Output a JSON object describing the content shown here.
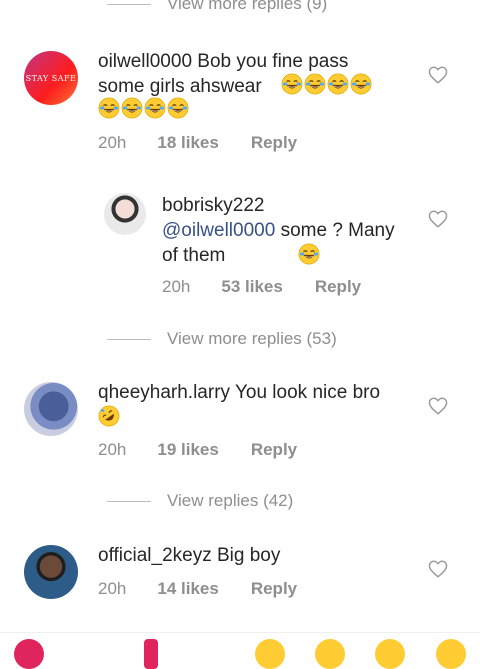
{
  "threads": [
    {
      "view_more": "View more replies (9)",
      "comment": {
        "username": "oilwell0000",
        "text": "Bob you fine pass some girls ahswear",
        "avatar_text": "STAY SAFE",
        "time": "20h",
        "likes": "18 likes",
        "reply": "Reply"
      }
    },
    {
      "comment": {
        "username": "bobrisky222",
        "mention": "@oilwell0000",
        "text": " some ? Many of them",
        "time": "20h",
        "likes": "53 likes",
        "reply": "Reply"
      },
      "view_more": "View more replies (53)"
    },
    {
      "comment": {
        "username": "qheeyharh.larry",
        "text": "You look nice bro",
        "time": "20h",
        "likes": "19 likes",
        "reply": "Reply"
      },
      "view_more": "View replies (42)"
    },
    {
      "comment": {
        "username": "official_2keyz",
        "text": "Big boy",
        "time": "20h",
        "likes": "14 likes",
        "reply": "Reply"
      }
    }
  ],
  "icons": {
    "like": "heart-outline-icon",
    "laugh": "tears-of-joy-emoji",
    "rofl": "rolling-laughing-emoji"
  },
  "colors": {
    "mention": "#385185",
    "meta": "#8e8e8e",
    "heart": "#9b9b9b"
  }
}
